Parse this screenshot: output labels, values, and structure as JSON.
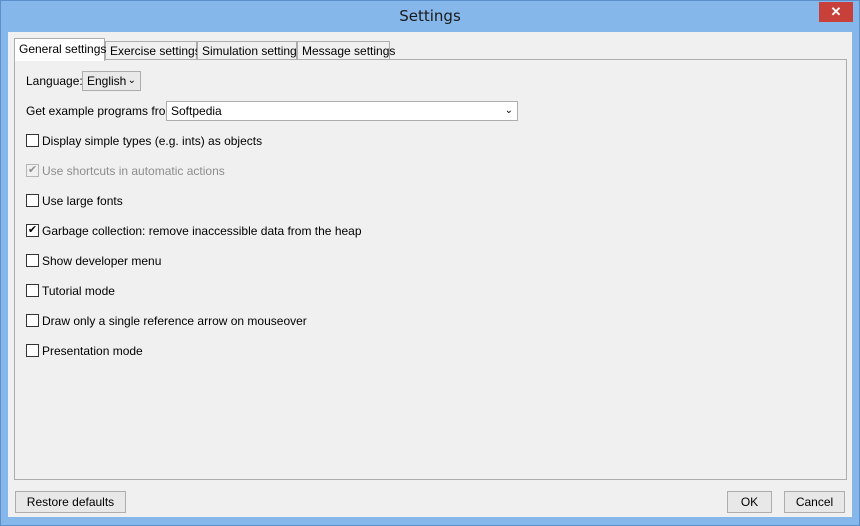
{
  "window": {
    "title": "Settings",
    "close_glyph": "✕"
  },
  "tabs": [
    {
      "label": "General settings",
      "active": true
    },
    {
      "label": "Exercise settings",
      "active": false
    },
    {
      "label": "Simulation settings",
      "active": false
    },
    {
      "label": "Message settings",
      "active": false
    }
  ],
  "general": {
    "language_label": "Language:",
    "language_value": "English",
    "programs_label": "Get example programs from:",
    "programs_value": "Softpedia",
    "chevron": "⌄",
    "options": [
      {
        "label": "Display simple types (e.g. ints) as objects",
        "checked": false,
        "enabled": true
      },
      {
        "label": "Use shortcuts in automatic actions",
        "checked": true,
        "enabled": false
      },
      {
        "label": "Use large fonts",
        "checked": false,
        "enabled": true
      },
      {
        "label": "Garbage collection: remove inaccessible data from the heap",
        "checked": true,
        "enabled": true
      },
      {
        "label": "Show developer menu",
        "checked": false,
        "enabled": true
      },
      {
        "label": "Tutorial mode",
        "checked": false,
        "enabled": true
      },
      {
        "label": "Draw only a single reference arrow on mouseover",
        "checked": false,
        "enabled": true
      },
      {
        "label": "Presentation mode",
        "checked": false,
        "enabled": true
      }
    ],
    "check_glyph": "✔"
  },
  "footer": {
    "restore_label": "Restore defaults",
    "ok_label": "OK",
    "cancel_label": "Cancel"
  }
}
